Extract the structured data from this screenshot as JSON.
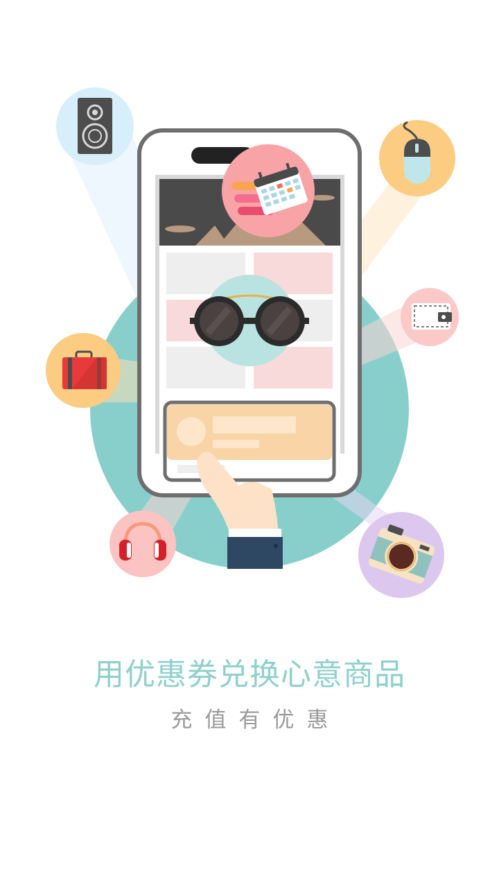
{
  "onboarding": {
    "headline": "用优惠券兑换心意商品",
    "subline": "充值有优惠"
  },
  "colors": {
    "background": "#ffffff",
    "big_circle": "#88cfcc",
    "headline": "#8fd0cd",
    "subline": "#9a9a9a",
    "phone_frame": "#6e6e6e",
    "card": "#f8d4a6"
  },
  "icons": [
    "speaker-icon",
    "mouse-icon",
    "calendar-icon",
    "wallet-icon",
    "suitcase-icon",
    "sunglasses-icon",
    "headphones-icon",
    "camera-icon",
    "hand-icon"
  ]
}
